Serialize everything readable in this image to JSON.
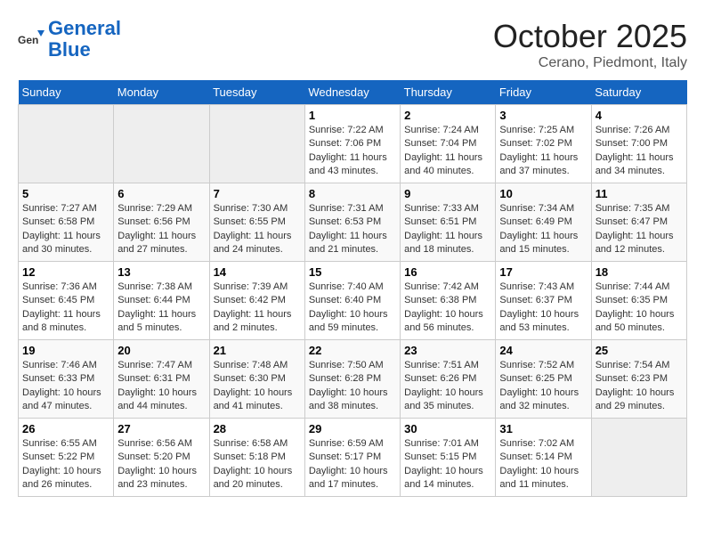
{
  "header": {
    "logo_line1": "General",
    "logo_line2": "Blue",
    "month": "October 2025",
    "location": "Cerano, Piedmont, Italy"
  },
  "days_of_week": [
    "Sunday",
    "Monday",
    "Tuesday",
    "Wednesday",
    "Thursday",
    "Friday",
    "Saturday"
  ],
  "weeks": [
    [
      {
        "day": "",
        "info": ""
      },
      {
        "day": "",
        "info": ""
      },
      {
        "day": "",
        "info": ""
      },
      {
        "day": "1",
        "info": "Sunrise: 7:22 AM\nSunset: 7:06 PM\nDaylight: 11 hours and 43 minutes."
      },
      {
        "day": "2",
        "info": "Sunrise: 7:24 AM\nSunset: 7:04 PM\nDaylight: 11 hours and 40 minutes."
      },
      {
        "day": "3",
        "info": "Sunrise: 7:25 AM\nSunset: 7:02 PM\nDaylight: 11 hours and 37 minutes."
      },
      {
        "day": "4",
        "info": "Sunrise: 7:26 AM\nSunset: 7:00 PM\nDaylight: 11 hours and 34 minutes."
      }
    ],
    [
      {
        "day": "5",
        "info": "Sunrise: 7:27 AM\nSunset: 6:58 PM\nDaylight: 11 hours and 30 minutes."
      },
      {
        "day": "6",
        "info": "Sunrise: 7:29 AM\nSunset: 6:56 PM\nDaylight: 11 hours and 27 minutes."
      },
      {
        "day": "7",
        "info": "Sunrise: 7:30 AM\nSunset: 6:55 PM\nDaylight: 11 hours and 24 minutes."
      },
      {
        "day": "8",
        "info": "Sunrise: 7:31 AM\nSunset: 6:53 PM\nDaylight: 11 hours and 21 minutes."
      },
      {
        "day": "9",
        "info": "Sunrise: 7:33 AM\nSunset: 6:51 PM\nDaylight: 11 hours and 18 minutes."
      },
      {
        "day": "10",
        "info": "Sunrise: 7:34 AM\nSunset: 6:49 PM\nDaylight: 11 hours and 15 minutes."
      },
      {
        "day": "11",
        "info": "Sunrise: 7:35 AM\nSunset: 6:47 PM\nDaylight: 11 hours and 12 minutes."
      }
    ],
    [
      {
        "day": "12",
        "info": "Sunrise: 7:36 AM\nSunset: 6:45 PM\nDaylight: 11 hours and 8 minutes."
      },
      {
        "day": "13",
        "info": "Sunrise: 7:38 AM\nSunset: 6:44 PM\nDaylight: 11 hours and 5 minutes."
      },
      {
        "day": "14",
        "info": "Sunrise: 7:39 AM\nSunset: 6:42 PM\nDaylight: 11 hours and 2 minutes."
      },
      {
        "day": "15",
        "info": "Sunrise: 7:40 AM\nSunset: 6:40 PM\nDaylight: 10 hours and 59 minutes."
      },
      {
        "day": "16",
        "info": "Sunrise: 7:42 AM\nSunset: 6:38 PM\nDaylight: 10 hours and 56 minutes."
      },
      {
        "day": "17",
        "info": "Sunrise: 7:43 AM\nSunset: 6:37 PM\nDaylight: 10 hours and 53 minutes."
      },
      {
        "day": "18",
        "info": "Sunrise: 7:44 AM\nSunset: 6:35 PM\nDaylight: 10 hours and 50 minutes."
      }
    ],
    [
      {
        "day": "19",
        "info": "Sunrise: 7:46 AM\nSunset: 6:33 PM\nDaylight: 10 hours and 47 minutes."
      },
      {
        "day": "20",
        "info": "Sunrise: 7:47 AM\nSunset: 6:31 PM\nDaylight: 10 hours and 44 minutes."
      },
      {
        "day": "21",
        "info": "Sunrise: 7:48 AM\nSunset: 6:30 PM\nDaylight: 10 hours and 41 minutes."
      },
      {
        "day": "22",
        "info": "Sunrise: 7:50 AM\nSunset: 6:28 PM\nDaylight: 10 hours and 38 minutes."
      },
      {
        "day": "23",
        "info": "Sunrise: 7:51 AM\nSunset: 6:26 PM\nDaylight: 10 hours and 35 minutes."
      },
      {
        "day": "24",
        "info": "Sunrise: 7:52 AM\nSunset: 6:25 PM\nDaylight: 10 hours and 32 minutes."
      },
      {
        "day": "25",
        "info": "Sunrise: 7:54 AM\nSunset: 6:23 PM\nDaylight: 10 hours and 29 minutes."
      }
    ],
    [
      {
        "day": "26",
        "info": "Sunrise: 6:55 AM\nSunset: 5:22 PM\nDaylight: 10 hours and 26 minutes."
      },
      {
        "day": "27",
        "info": "Sunrise: 6:56 AM\nSunset: 5:20 PM\nDaylight: 10 hours and 23 minutes."
      },
      {
        "day": "28",
        "info": "Sunrise: 6:58 AM\nSunset: 5:18 PM\nDaylight: 10 hours and 20 minutes."
      },
      {
        "day": "29",
        "info": "Sunrise: 6:59 AM\nSunset: 5:17 PM\nDaylight: 10 hours and 17 minutes."
      },
      {
        "day": "30",
        "info": "Sunrise: 7:01 AM\nSunset: 5:15 PM\nDaylight: 10 hours and 14 minutes."
      },
      {
        "day": "31",
        "info": "Sunrise: 7:02 AM\nSunset: 5:14 PM\nDaylight: 10 hours and 11 minutes."
      },
      {
        "day": "",
        "info": ""
      }
    ]
  ]
}
